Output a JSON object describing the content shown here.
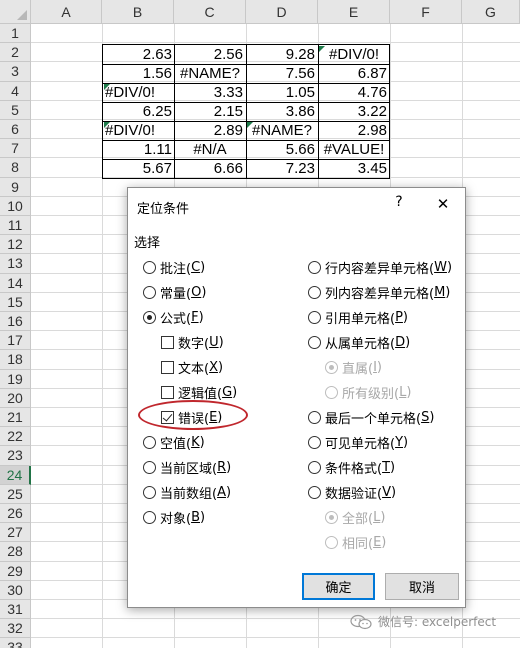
{
  "sheet": {
    "columns": [
      "A",
      "B",
      "C",
      "D",
      "E",
      "F",
      "G"
    ],
    "rows": [
      "1",
      "2",
      "3",
      "4",
      "5",
      "6",
      "7",
      "8",
      "9",
      "10",
      "11",
      "12",
      "13",
      "14",
      "15",
      "16",
      "17",
      "18",
      "19",
      "20",
      "21",
      "22",
      "23",
      "24",
      "25",
      "26",
      "27",
      "28",
      "29",
      "30",
      "31",
      "32",
      "33"
    ],
    "active_row": "24",
    "cells": [
      [
        "2.63",
        "2.56",
        "9.28",
        "#DIV/0!"
      ],
      [
        "1.56",
        "#NAME?",
        "7.56",
        "6.87"
      ],
      [
        "#DIV/0!",
        "3.33",
        "1.05",
        "4.76"
      ],
      [
        "6.25",
        "2.15",
        "3.86",
        "3.22"
      ],
      [
        "#DIV/0!",
        "2.89",
        "#NAME?",
        "2.98"
      ],
      [
        "1.11",
        "#N/A",
        "5.66",
        "#VALUE!"
      ],
      [
        "5.67",
        "6.66",
        "7.23",
        "3.45"
      ]
    ]
  },
  "dialog": {
    "title": "定位条件",
    "help": "?",
    "close": "✕",
    "group_label": "选择",
    "left_options": [
      {
        "label": "批注(",
        "key": "C",
        "tail": ")"
      },
      {
        "label": "常量(",
        "key": "O",
        "tail": ")"
      },
      {
        "label": "公式(",
        "key": "F",
        "tail": ")"
      },
      {
        "label": "数字(",
        "key": "U",
        "tail": ")"
      },
      {
        "label": "文本(",
        "key": "X",
        "tail": ")"
      },
      {
        "label": "逻辑值(",
        "key": "G",
        "tail": ")"
      },
      {
        "label": "错误(",
        "key": "E",
        "tail": ")"
      },
      {
        "label": "空值(",
        "key": "K",
        "tail": ")"
      },
      {
        "label": "当前区域(",
        "key": "R",
        "tail": ")"
      },
      {
        "label": "当前数组(",
        "key": "A",
        "tail": ")"
      },
      {
        "label": "对象(",
        "key": "B",
        "tail": ")"
      }
    ],
    "right_options": [
      {
        "label": "行内容差异单元格(",
        "key": "W",
        "tail": ")"
      },
      {
        "label": "列内容差异单元格(",
        "key": "M",
        "tail": ")"
      },
      {
        "label": "引用单元格(",
        "key": "P",
        "tail": ")"
      },
      {
        "label": "从属单元格(",
        "key": "D",
        "tail": ")"
      },
      {
        "label": "直属(",
        "key": "I",
        "tail": ")"
      },
      {
        "label": "所有级别(",
        "key": "L",
        "tail": ")"
      },
      {
        "label": "最后一个单元格(",
        "key": "S",
        "tail": ")"
      },
      {
        "label": "可见单元格(",
        "key": "Y",
        "tail": ")"
      },
      {
        "label": "条件格式(",
        "key": "T",
        "tail": ")"
      },
      {
        "label": "数据验证(",
        "key": "V",
        "tail": ")"
      },
      {
        "label": "全部(",
        "key": "L",
        "tail": ")"
      },
      {
        "label": "相同(",
        "key": "E",
        "tail": ")"
      }
    ],
    "ok_label": "确定",
    "cancel_label": "取消"
  },
  "watermark": {
    "text": "微信号: excelperfect"
  },
  "colors": {
    "error_flag": "#1e7b4a",
    "highlight_oval": "#c0272d",
    "primary_border": "#0078d7"
  }
}
